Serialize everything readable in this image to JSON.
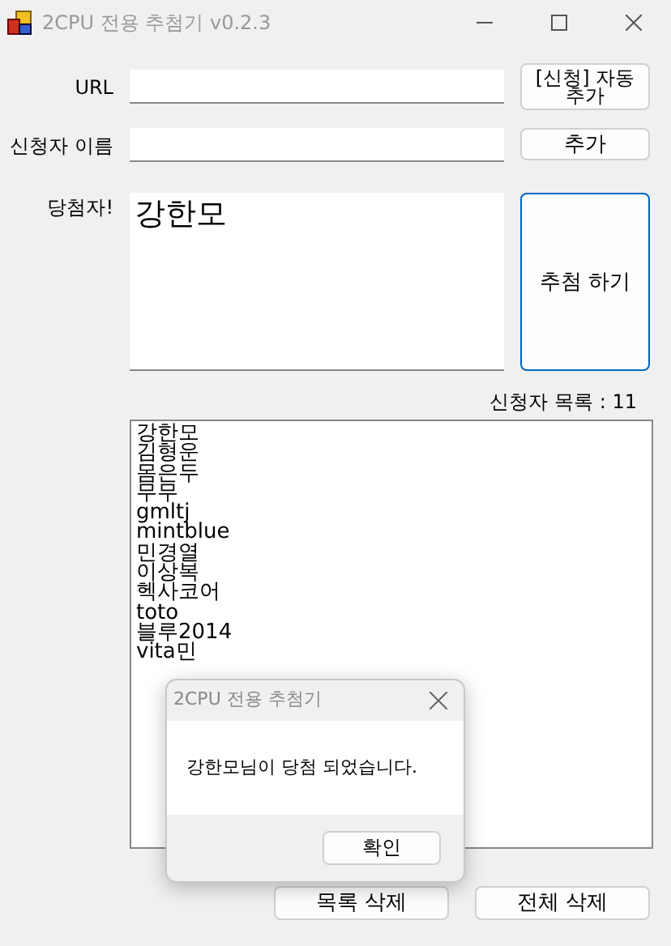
{
  "window": {
    "title": "2CPU 전용 추첨기 v0.2.3"
  },
  "url": {
    "label": "URL",
    "button": "[신청] 자동 추가"
  },
  "applicant_name": {
    "label": "신청자 이름",
    "button": "추가"
  },
  "winner": {
    "label": "당첨자!",
    "value": "강한모",
    "button": "추첨 하기",
    "focused": true
  },
  "applicants": {
    "count_label": "신청자 목록 : 11",
    "items": [
      "강한모",
      "김형운",
      "몸은두",
      "무무",
      "gmltj",
      "mintblue",
      "민경열",
      "이상복",
      "헥사코어",
      "toto",
      "블루2014",
      "vita민"
    ]
  },
  "buttons": [
    "목록 삭제",
    "전체 삭제"
  ],
  "dialog": {
    "title": "2CPU 전용 추첨기",
    "message": "강한모님이 당첨 되었습니다.",
    "button": "확인"
  }
}
